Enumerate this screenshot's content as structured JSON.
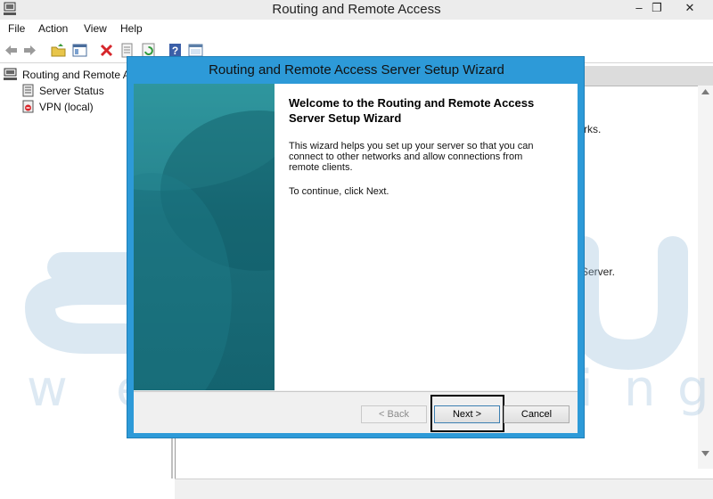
{
  "window": {
    "title": "Routing and Remote Access",
    "controls": {
      "minimize": "–",
      "restore": "❐",
      "close": "✕"
    }
  },
  "menu": {
    "items": [
      "File",
      "Action",
      "View",
      "Help"
    ]
  },
  "toolbar": {
    "icons": [
      "back-arrow-icon",
      "forward-arrow-icon",
      "folder-up-icon",
      "console-tree-icon",
      "delete-icon",
      "export-list-icon",
      "refresh-icon",
      "help-icon",
      "properties-icon"
    ]
  },
  "tree": {
    "root": "Routing and Remote A",
    "items": [
      "Server Status",
      "VPN (local)"
    ]
  },
  "right_pane": {
    "fragments": [
      "rks.",
      "Server."
    ]
  },
  "watermark": {
    "brand": "accu",
    "sub": "webhosting"
  },
  "wizard": {
    "title": "Routing and Remote Access Server Setup Wizard",
    "heading": "Welcome to the Routing and Remote Access Server Setup Wizard",
    "paragraphs": [
      "This wizard helps you set up your server so that you can connect to other networks and allow connections from remote clients.",
      "To continue, click Next."
    ],
    "buttons": {
      "back": "< Back",
      "next": "Next >",
      "cancel": "Cancel"
    }
  },
  "colors": {
    "dialog_frame": "#2d9ad8",
    "banner": "#1b6e7a",
    "highlight_box": "#000000"
  }
}
